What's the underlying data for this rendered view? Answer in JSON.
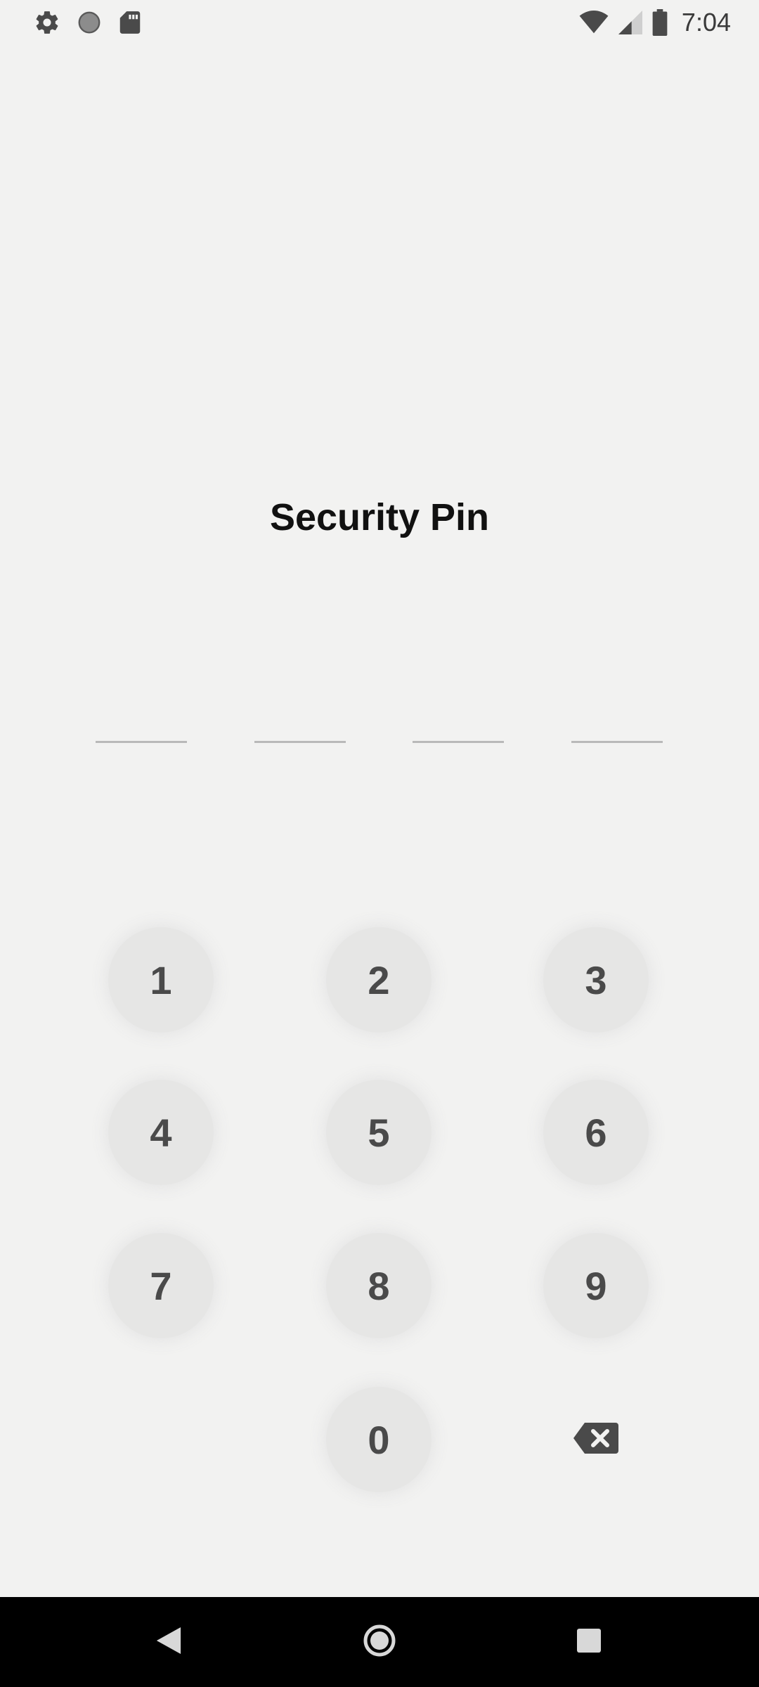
{
  "status_bar": {
    "time": "7:04",
    "left_icons": [
      "gear-icon",
      "circle-icon",
      "sd-card-icon"
    ],
    "right_icons": [
      "wifi-icon",
      "signal-icon",
      "battery-icon"
    ]
  },
  "title": "Security Pin",
  "pin": {
    "length": 4,
    "entered": ""
  },
  "keypad": {
    "keys": [
      "1",
      "2",
      "3",
      "4",
      "5",
      "6",
      "7",
      "8",
      "9",
      "0"
    ],
    "backspace_icon": "backspace-icon"
  },
  "nav": {
    "buttons": [
      "back-icon",
      "home-icon",
      "recents-icon"
    ]
  },
  "colors": {
    "background": "#f2f2f1",
    "key_bg": "#e6e6e5",
    "key_text": "#4a4a4a",
    "title": "#111111",
    "nav_bar": "#000000"
  }
}
